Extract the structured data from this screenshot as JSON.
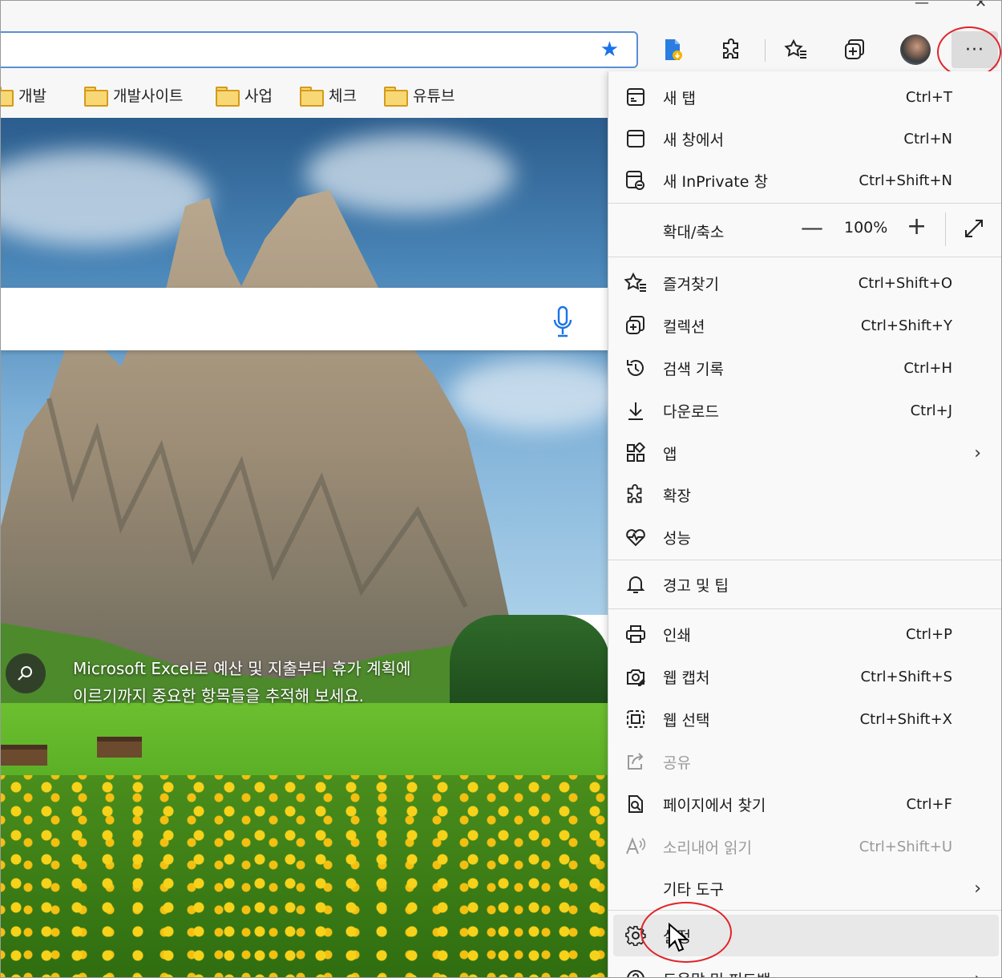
{
  "window": {
    "minimize_glyph": "—",
    "close_glyph": "✕"
  },
  "toolbar": {
    "favorite_star_icon": "star-filled-icon",
    "more_label": "···",
    "accent": "#1a73e8",
    "highlight_circle_color": "#e0242a"
  },
  "bookmarks": [
    {
      "label": "개발"
    },
    {
      "label": "개발사이트"
    },
    {
      "label": "사업"
    },
    {
      "label": "체크"
    },
    {
      "label": "유튜브"
    }
  ],
  "page": {
    "tip_text": "Microsoft Excel로 예산 및 지출부터 휴가 계획에 이르기까지 중요한 항목들을 추적해 보세요."
  },
  "menu": {
    "new_tab": {
      "label": "새 탭",
      "shortcut": "Ctrl+T"
    },
    "new_window": {
      "label": "새 창에서",
      "shortcut": "Ctrl+N"
    },
    "new_inprivate": {
      "label": "새 InPrivate 창",
      "shortcut": "Ctrl+Shift+N"
    },
    "zoom": {
      "label": "확대/축소",
      "minus": "—",
      "value": "100%",
      "plus": "+"
    },
    "favorites": {
      "label": "즐겨찾기",
      "shortcut": "Ctrl+Shift+O"
    },
    "collections": {
      "label": "컬렉션",
      "shortcut": "Ctrl+Shift+Y"
    },
    "history": {
      "label": "검색 기록",
      "shortcut": "Ctrl+H"
    },
    "downloads": {
      "label": "다운로드",
      "shortcut": "Ctrl+J"
    },
    "apps": {
      "label": "앱",
      "chevron": "›"
    },
    "extensions": {
      "label": "확장"
    },
    "performance": {
      "label": "성능"
    },
    "alerts": {
      "label": "경고 및 팁"
    },
    "print": {
      "label": "인쇄",
      "shortcut": "Ctrl+P"
    },
    "web_capture": {
      "label": "웹 캡처",
      "shortcut": "Ctrl+Shift+S"
    },
    "web_select": {
      "label": "웹 선택",
      "shortcut": "Ctrl+Shift+X"
    },
    "share": {
      "label": "공유"
    },
    "find": {
      "label": "페이지에서 찾기",
      "shortcut": "Ctrl+F"
    },
    "read_aloud": {
      "label": "소리내어 읽기",
      "shortcut": "Ctrl+Shift+U"
    },
    "more_tools": {
      "label": "기타 도구",
      "chevron": "›"
    },
    "settings": {
      "label": "설정"
    },
    "help": {
      "label": "도움말 및 피드백",
      "chevron": "›"
    }
  }
}
